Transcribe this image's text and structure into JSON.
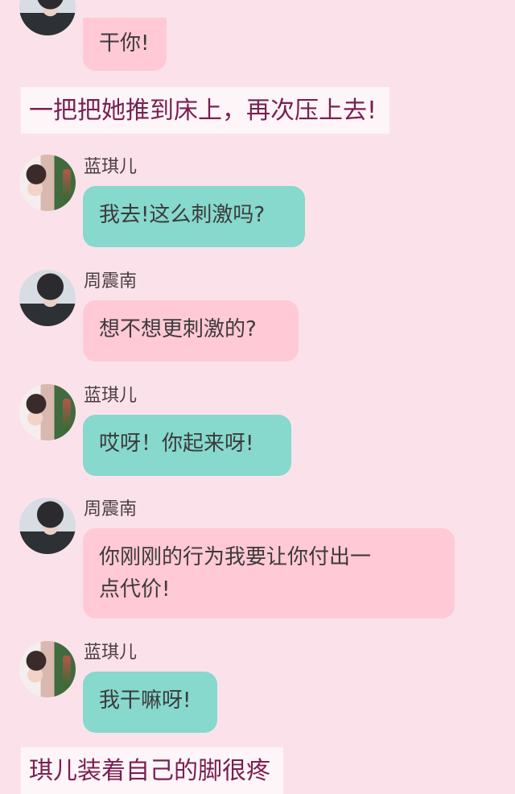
{
  "messages": [
    {
      "id": "m0",
      "speaker": "",
      "text": "干你!"
    },
    {
      "id": "m2",
      "speaker": "蓝琪儿",
      "text": "我去!这么刺激吗?"
    },
    {
      "id": "m3",
      "speaker": "周震南",
      "text": "想不想更刺激的?"
    },
    {
      "id": "m4",
      "speaker": "蓝琪儿",
      "text": "哎呀！你起来呀!"
    },
    {
      "id": "m5",
      "speaker": "周震南",
      "text_line1": "你刚刚的行为我要让你付出一",
      "text_line2": "点代价!"
    },
    {
      "id": "m6",
      "speaker": "蓝琪儿",
      "text": "我干嘛呀!"
    }
  ],
  "narrations": [
    "一把把她推到床上，再次压上去!",
    "琪儿装着自己的脚很疼"
  ],
  "colors": {
    "background": "#fbe2ea",
    "teal_bubble": "#86d9cc",
    "pink_bubble": "#ffc9d5",
    "narration_text": "#7a1f52"
  }
}
